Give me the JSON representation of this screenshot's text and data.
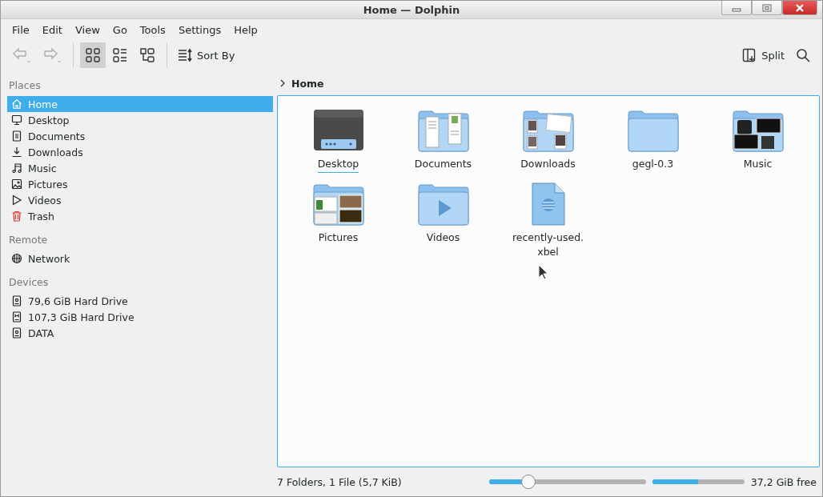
{
  "window": {
    "title": "Home — Dolphin"
  },
  "menu": [
    "File",
    "Edit",
    "View",
    "Go",
    "Tools",
    "Settings",
    "Help"
  ],
  "toolbar": {
    "views": [
      {
        "kind": "icons",
        "selected": true
      },
      {
        "kind": "details",
        "selected": false
      },
      {
        "kind": "tree",
        "selected": false
      }
    ],
    "sort_label": "Sort By",
    "split_label": "Split"
  },
  "sidebar": [
    {
      "heading": "Places",
      "items": [
        {
          "label": "Home",
          "kind": "home",
          "selected": true
        },
        {
          "label": "Desktop",
          "kind": "desktop",
          "selected": false
        },
        {
          "label": "Documents",
          "kind": "documents",
          "selected": false
        },
        {
          "label": "Downloads",
          "kind": "downloads",
          "selected": false
        },
        {
          "label": "Music",
          "kind": "music",
          "selected": false
        },
        {
          "label": "Pictures",
          "kind": "pictures",
          "selected": false
        },
        {
          "label": "Videos",
          "kind": "videos",
          "selected": false
        },
        {
          "label": "Trash",
          "kind": "trash",
          "selected": false
        }
      ]
    },
    {
      "heading": "Remote",
      "items": [
        {
          "label": "Network",
          "kind": "network",
          "selected": false
        }
      ]
    },
    {
      "heading": "Devices",
      "items": [
        {
          "label": "79,6 GiB Hard Drive",
          "kind": "drive",
          "selected": false
        },
        {
          "label": "107,3 GiB Hard Drive",
          "kind": "drive-alt",
          "selected": false
        },
        {
          "label": "DATA",
          "kind": "drive",
          "selected": false
        }
      ]
    }
  ],
  "breadcrumb": "Home",
  "files": [
    {
      "name": "Desktop",
      "kind": "desktop",
      "focused": true
    },
    {
      "name": "Documents",
      "kind": "documents",
      "focused": false
    },
    {
      "name": "Downloads",
      "kind": "downloads",
      "focused": false
    },
    {
      "name": "gegl-0.3",
      "kind": "folder",
      "focused": false
    },
    {
      "name": "Music",
      "kind": "music",
      "focused": false
    },
    {
      "name": "Pictures",
      "kind": "pictures",
      "focused": false
    },
    {
      "name": "Videos",
      "kind": "videos",
      "focused": false
    },
    {
      "name": "recently-used.\nxbel",
      "kind": "file",
      "focused": false
    }
  ],
  "status_bar": {
    "summary": "7 Folders, 1 File (5,7 KiB)",
    "zoom": {
      "level": 0.25
    },
    "disk": {
      "level": 0.5
    },
    "free": "37,2 GiB free"
  }
}
